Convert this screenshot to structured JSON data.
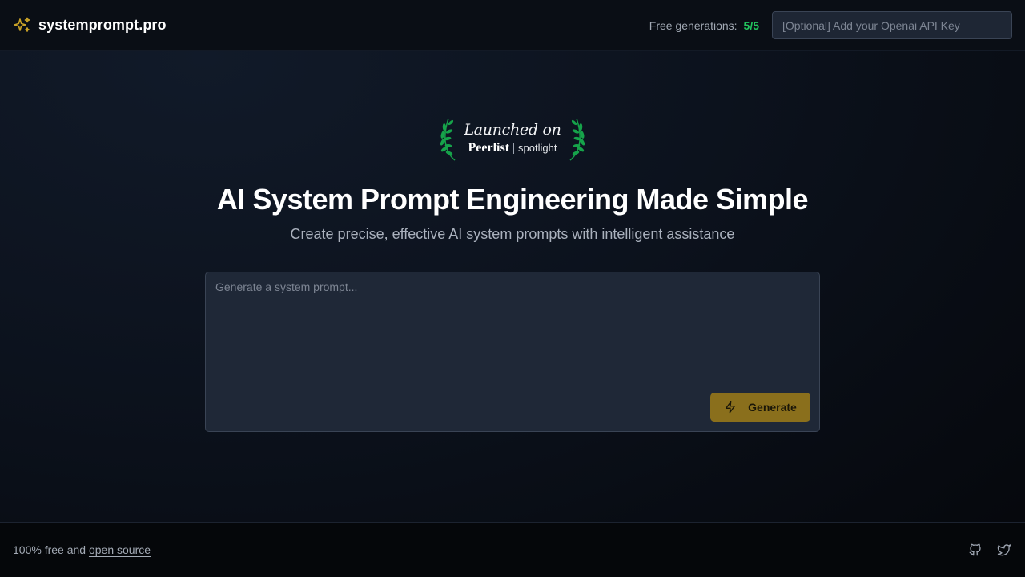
{
  "header": {
    "brand_name": "systemprompt.pro",
    "brand_icon": "sparkles-icon",
    "free_generations_label": "Free generations:",
    "free_generations_count": "5/5",
    "api_key_placeholder": "[Optional] Add your Openai API Key"
  },
  "badge": {
    "launched_text": "Launched on",
    "brand": "Peerlist",
    "sub": "spotlight"
  },
  "hero": {
    "title": "AI System Prompt Engineering Made Simple",
    "subtitle": "Create precise, effective AI system prompts with intelligent assistance"
  },
  "prompt": {
    "placeholder": "Generate a system prompt...",
    "value": "",
    "generate_label": "Generate",
    "generate_icon": "lightning-icon"
  },
  "footer": {
    "text_prefix": "100% free and",
    "link_label": "open source",
    "icons": [
      "github-icon",
      "twitter-icon"
    ]
  },
  "colors": {
    "accent": "#8a6f1c",
    "brand_icon": "#c9a227",
    "count_green": "#22c55e",
    "laurel_green": "#16a34a"
  }
}
